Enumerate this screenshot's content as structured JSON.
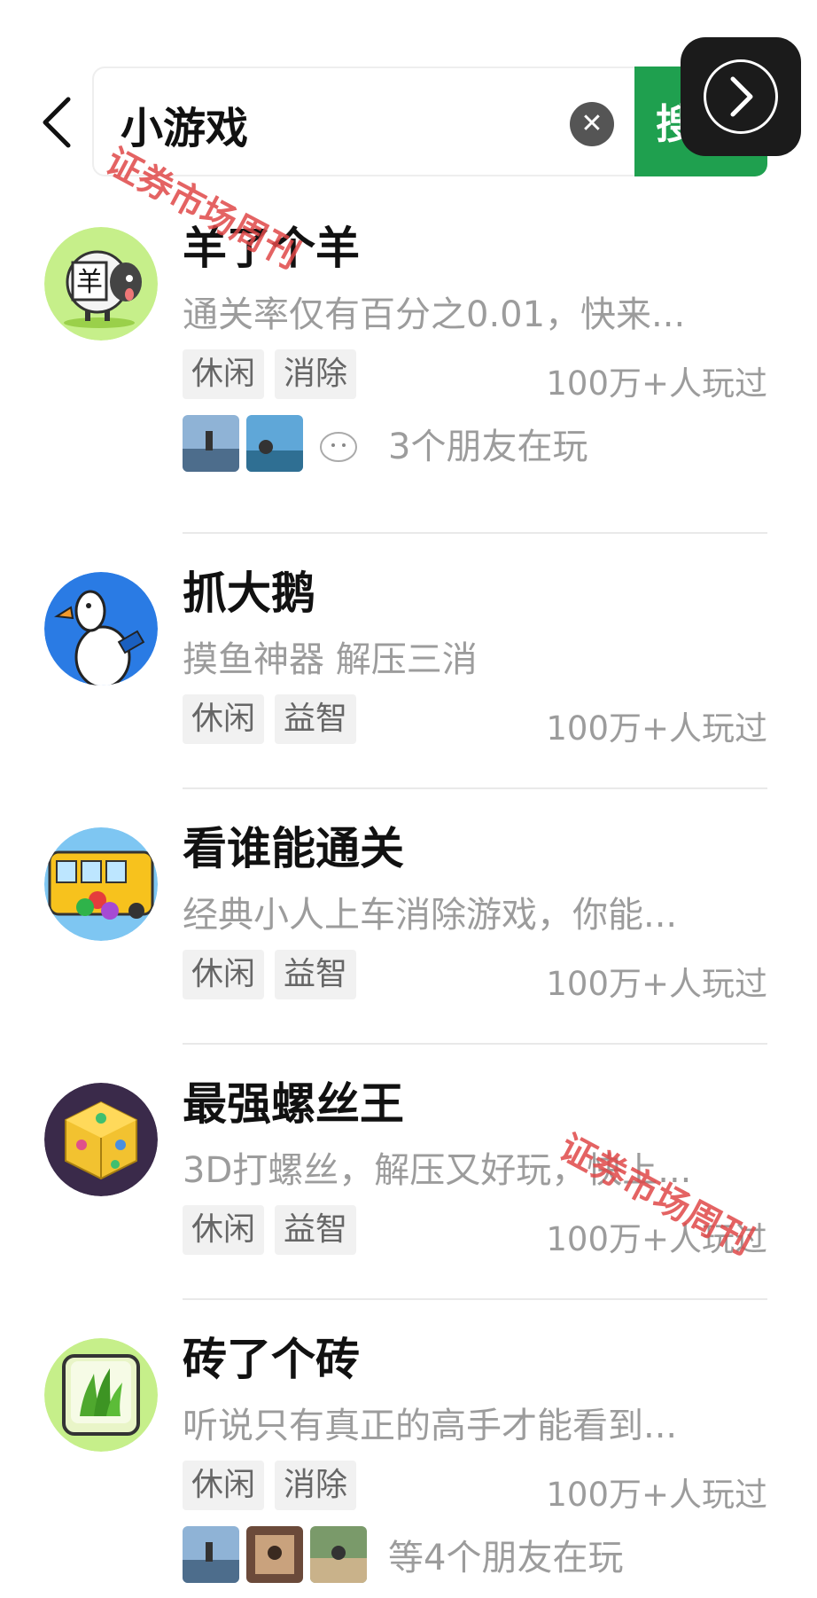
{
  "header": {
    "back_icon": "chevron-left-icon",
    "search_value": "小游戏",
    "clear_icon": "close-icon",
    "search_button_label": "搜",
    "float_icon": "chevron-right-icon"
  },
  "games": [
    {
      "title": "羊了个羊",
      "desc": "通关率仅有百分之0.01，快来...",
      "tags": [
        "休闲",
        "消除"
      ],
      "played": "100万+人玩过",
      "friends_text": "3个朋友在玩",
      "avatar_icon": "sheep-game-icon",
      "avatar_color": "#c6ef8a"
    },
    {
      "title": "抓大鹅",
      "desc": "摸鱼神器 解压三消",
      "tags": [
        "休闲",
        "益智"
      ],
      "played": "100万+人玩过",
      "avatar_icon": "goose-game-icon",
      "avatar_color": "#2a7be4"
    },
    {
      "title": "看谁能通关",
      "desc": "经典小人上车消除游戏，你能...",
      "tags": [
        "休闲",
        "益智"
      ],
      "played": "100万+人玩过",
      "avatar_icon": "bus-game-icon",
      "avatar_color": "#f7c21d"
    },
    {
      "title": "最强螺丝王",
      "desc": "3D打螺丝，解压又好玩，快上...",
      "tags": [
        "休闲",
        "益智"
      ],
      "played": "100万+人玩过",
      "avatar_icon": "screw-cube-game-icon",
      "avatar_color": "#3a2a4a"
    },
    {
      "title": "砖了个砖",
      "desc": "听说只有真正的高手才能看到...",
      "tags": [
        "休闲",
        "消除"
      ],
      "played": "100万+人玩过",
      "friends_text": "等4个朋友在玩",
      "avatar_icon": "grass-tile-game-icon",
      "avatar_color": "#c6ef8a"
    }
  ],
  "watermark": {
    "text": "证券市场周刊"
  }
}
